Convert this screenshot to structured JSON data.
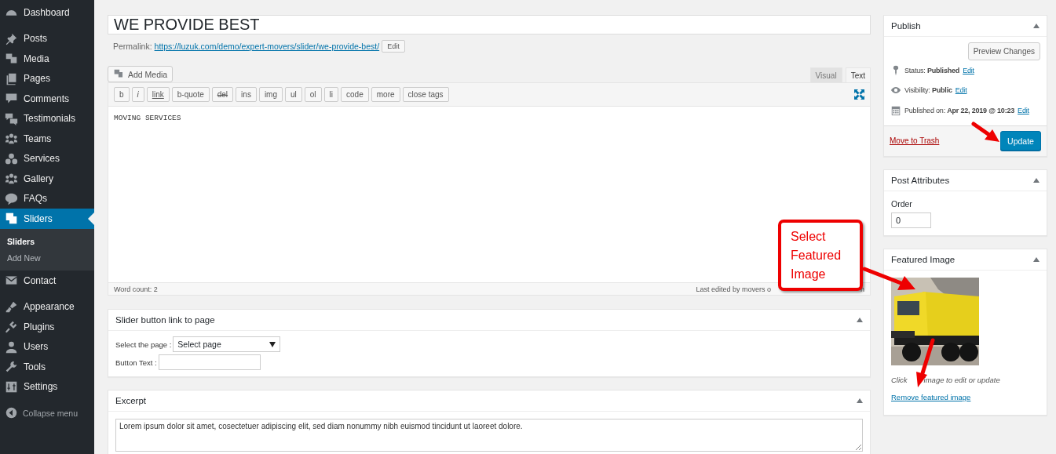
{
  "sidebar": {
    "groups": [
      [
        {
          "label": "Dashboard",
          "selected": false
        }
      ],
      [
        {
          "label": "Posts",
          "selected": false
        },
        {
          "label": "Media",
          "selected": false
        },
        {
          "label": "Pages",
          "selected": false
        },
        {
          "label": "Comments",
          "selected": false
        },
        {
          "label": "Testimonials",
          "selected": false
        },
        {
          "label": "Teams",
          "selected": false
        },
        {
          "label": "Services",
          "selected": false
        },
        {
          "label": "Gallery",
          "selected": false
        },
        {
          "label": "FAQs",
          "selected": false
        },
        {
          "label": "Sliders",
          "selected": true,
          "children": [
            {
              "label": "Sliders",
              "selected": true
            },
            {
              "label": "Add New",
              "selected": false
            }
          ]
        },
        {
          "label": "Contact",
          "selected": false
        }
      ],
      [
        {
          "label": "Appearance",
          "selected": false
        },
        {
          "label": "Plugins",
          "selected": false
        },
        {
          "label": "Users",
          "selected": false
        },
        {
          "label": "Tools",
          "selected": false
        },
        {
          "label": "Settings",
          "selected": false
        }
      ]
    ],
    "collapse": "Collapse menu"
  },
  "post": {
    "title": "WE PROVIDE BEST",
    "permalink_label": "Permalink:",
    "permalink_url": "https://luzuk.com/demo/expert-movers/slider/we-provide-best/",
    "permalink_edit": "Edit"
  },
  "editor": {
    "add_media": "Add Media",
    "tabs": [
      {
        "label": "Visual",
        "selected": false
      },
      {
        "label": "Text",
        "selected": true
      }
    ],
    "quicktags": [
      {
        "label": "b",
        "kind": "plain"
      },
      {
        "label": "i",
        "kind": "italic"
      },
      {
        "label": "link",
        "kind": "underline"
      },
      {
        "label": "b-quote",
        "kind": "plain"
      },
      {
        "label": "del",
        "kind": "strike"
      },
      {
        "label": "ins",
        "kind": "plain"
      },
      {
        "label": "img",
        "kind": "plain"
      },
      {
        "label": "ul",
        "kind": "plain"
      },
      {
        "label": "ol",
        "kind": "plain"
      },
      {
        "label": "li",
        "kind": "plain"
      },
      {
        "label": "code",
        "kind": "plain"
      },
      {
        "label": "more",
        "kind": "plain"
      },
      {
        "label": "close tags",
        "kind": "plain"
      }
    ],
    "content": "MOVING SERVICES",
    "word_count": "Word count: 2",
    "last_edited": [
      "Last edited by movers o",
      "n"
    ]
  },
  "slider_button_box": {
    "title": "Slider button link to page",
    "select_label": "Select the page :",
    "select_value": "Select page",
    "button_text_label": "Button Text :"
  },
  "excerpt": {
    "title": "Excerpt",
    "value": "Lorem ipsum dolor sit amet, cosectetuer adipiscing elit, sed diam nonummy nibh euismod tincidunt ut laoreet dolore."
  },
  "publish": {
    "title": "Publish",
    "preview": "Preview Changes",
    "rows": [
      {
        "text": "Status: **Published**",
        "link": "Edit"
      },
      {
        "text": "Visibility: **Public**",
        "link": "Edit"
      },
      {
        "text": "Published on: **Apr 22, 2019 @ 10:23**",
        "link": "Edit"
      }
    ],
    "trash": "Move to Trash",
    "update": "Update"
  },
  "post_attributes": {
    "title": "Post Attributes",
    "order_label": "Order",
    "order": "0"
  },
  "featured_image": {
    "title": "Featured Image",
    "image": {
      "kind": "picture"
    },
    "hint": [
      "Click",
      "image to edit or update"
    ],
    "remove": "Remove featured image"
  },
  "annotation": {
    "callout": "Select Featured Image"
  }
}
